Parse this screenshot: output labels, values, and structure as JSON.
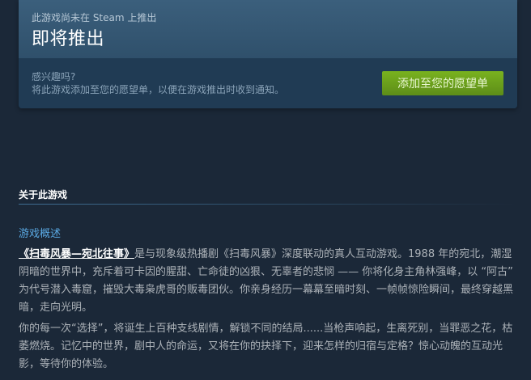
{
  "coming_soon": {
    "note": "此游戏尚未在 Steam 上推出",
    "title": "即将推出",
    "interest_question": "感兴趣吗?",
    "interest_description": "将此游戏添加至您的愿望单，以便在游戏推出时收到通知。",
    "wishlist_button": "添加至您的愿望单"
  },
  "about": {
    "heading": "关于此游戏",
    "overview_title": "游戏概述",
    "paragraph1_link": "《扫毒风暴—宛北往事》",
    "paragraph1_text": "是与现象级热播剧《扫毒风暴》深度联动的真人互动游戏。1988 年的宛北，潮湿阴暗的世界中，充斥着可卡因的腥甜、亡命徒的凶狠、无辜者的悲悯 —— 你将化身主角林强峰，以 “阿古” 为代号潜入毒窟，摧毁大毒枭虎哥的贩毒团伙。你亲身经历一幕幕至暗时刻、一帧帧惊险瞬间，最终穿越黑暗，走向光明。",
    "paragraph2": "你的每一次“选择”，将诞生上百种支线剧情，解锁不同的结局......当枪声响起，生离死别，当罪恶之花，枯萎燃烧。记忆中的世界，剧中人的命运，又将在你的抉择下，迎来怎样的归宿与定格？惊心动魄的互动光影，等待你的体验。"
  },
  "colors": {
    "background": "#1b2838",
    "banner_top": "#3b5f7c",
    "banner_bottom": "#203b54",
    "button_green": "#75b022",
    "link_blue": "#5aa9e3",
    "body_text": "#acb2b8"
  }
}
